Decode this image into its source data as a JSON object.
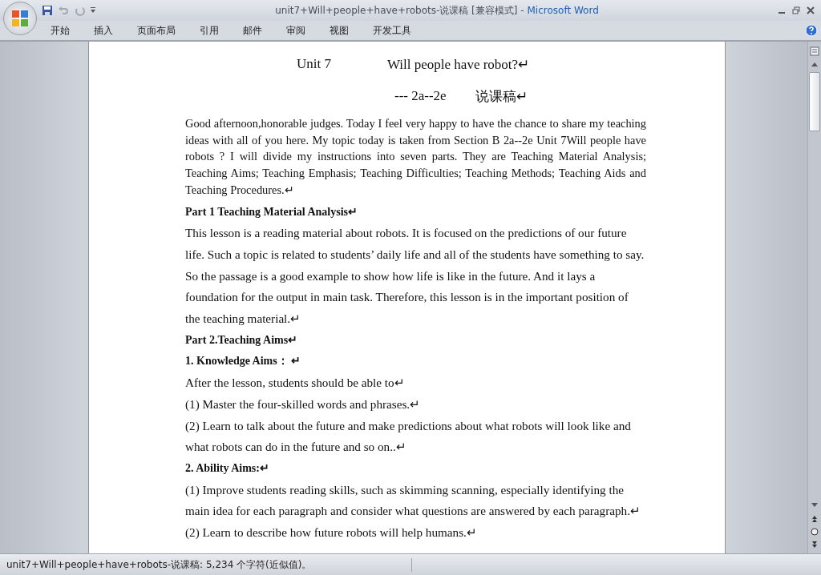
{
  "window": {
    "title": "unit7+Will+people+have+robots-说课稿 [兼容模式]",
    "separator": "-",
    "app_name": "Microsoft Word"
  },
  "tabs": [
    "开始",
    "插入",
    "页面布局",
    "引用",
    "邮件",
    "审阅",
    "视图",
    "开发工具"
  ],
  "document": [
    {
      "kind": "title",
      "parts": [
        "Unit 7",
        "Will people have robot?↵"
      ]
    },
    {
      "kind": "title",
      "parts": [
        "--- 2a--2e",
        "说课稿↵"
      ]
    },
    {
      "kind": "intro",
      "text": "Good afternoon,honorable judges. Today I feel very happy to have the chance to share my teaching ideas with all of you here. My topic today is taken from Section B 2a--2e Unit 7Will people have robots ? I will divide my instructions into seven parts. They are Teaching Material Analysis; Teaching Aims; Teaching Emphasis; Teaching Difficulties; Teaching Methods; Teaching Aids and Teaching Procedures.↵"
    },
    {
      "kind": "heading",
      "text": "Part 1 Teaching Material Analysis↵"
    },
    {
      "kind": "body",
      "text": "This lesson is a reading material about robots. It is focused on the predictions of our future life. Such a topic is related to students’ daily life and all of the students have something to say. So the passage is a good example to show how life is like in the future. And it lays a foundation for the output in main task. Therefore, this lesson is in the important position of the teaching material.↵"
    },
    {
      "kind": "heading",
      "text": "Part 2.Teaching Aims↵"
    },
    {
      "kind": "heading",
      "text": "1. Knowledge Aims： ↵"
    },
    {
      "kind": "body",
      "text": "After the lesson, students should be able to↵"
    },
    {
      "kind": "body",
      "text": "(1) Master the four-skilled words and phrases.↵"
    },
    {
      "kind": "body",
      "text": "(2) Learn to talk about the future and make predictions about what robots will look like and what robots can do in the future and so on..↵"
    },
    {
      "kind": "heading",
      "text": "2. Ability Aims:↵"
    },
    {
      "kind": "body",
      "text": "(1) Improve students reading skills, such as skimming scanning, especially identifying the main idea for each paragraph and consider what questions are answered by each paragraph.↵"
    },
    {
      "kind": "body",
      "text": "(2) Learn to describe how future robots will help humans.↵"
    }
  ],
  "status_bar": {
    "text": "unit7+Will+people+have+robots-说课稿: 5,234 个字符(近似值)。"
  }
}
